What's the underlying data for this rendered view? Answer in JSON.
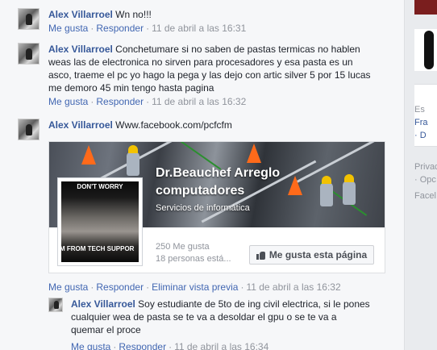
{
  "comments": [
    {
      "author": "Alex Villarroel",
      "text": "Wn no!!!",
      "actions": {
        "like": "Me gusta",
        "reply": "Responder",
        "time": "11 de abril a las 16:31"
      }
    },
    {
      "author": "Alex Villarroel",
      "text_lines": [
        "Conchetumare si no saben de pastas termicas no hablen",
        "weas las de electronica no sirven para procesadores y esa pasta es un",
        "asco, traeme el pc yo hago la pega y las dejo con artic silver 5 por 15 lucas",
        "me demoro 45 min tengo hasta pagina"
      ],
      "actions": {
        "like": "Me gusta",
        "reply": "Responder",
        "time": "11 de abril a las 16:32"
      }
    },
    {
      "author": "Alex Villarroel",
      "text": "Www.facebook.com/pcfcfm",
      "actions": {
        "like": "Me gusta",
        "reply": "Responder",
        "remove_preview": "Eliminar vista previa",
        "time": "11 de abril a las 16:32"
      }
    },
    {
      "author": "Alex Villarroel",
      "text_first": "Soy estudiante de 5to de ing civil electrica, si le pones",
      "text_lines": [
        "cualquier wea de pasta se te va a desoldar el gpu o se te va a",
        "quemar el proce"
      ],
      "actions": {
        "like": "Me gusta",
        "reply": "Responder",
        "time": "11 de abril a las 16:34"
      }
    }
  ],
  "link_card": {
    "page_name_line1": "Dr.Beauchef Arreglo",
    "page_name_line2": "computadores",
    "category": "Servicios de informática",
    "likes": "250 Me gusta",
    "talking": "18 personas está...",
    "like_button": "Me gusta esta página",
    "poster_top": "DON'T WORRY",
    "poster_bottom": "M FROM TECH SUPPOR",
    "colors": {
      "cone": "#ff6a1a",
      "helmet": "#f2c200"
    }
  },
  "sidebar": {
    "line1": "Es",
    "line2": "Fra",
    "line3": "· D",
    "line4": "Privac",
    "line5": "· Opc",
    "line6": "Facel"
  },
  "colors": {
    "link": "#4267b2",
    "author": "#365899",
    "meta": "#90949c"
  },
  "sep": "·"
}
